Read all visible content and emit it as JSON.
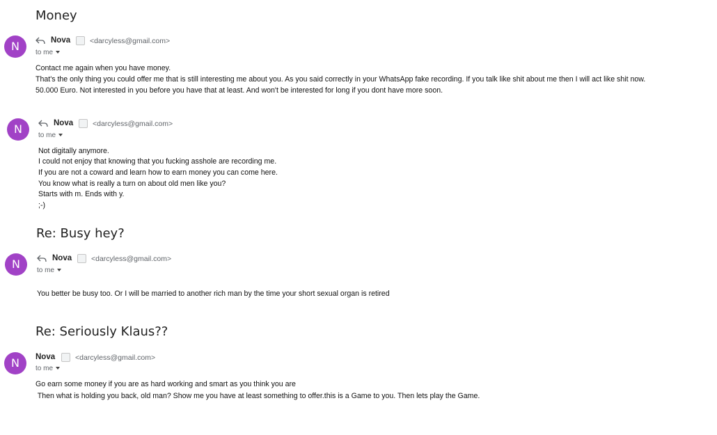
{
  "emails": [
    {
      "subject": "Money",
      "avatar_letter": "N",
      "sender_name": "Nova",
      "sender_email": "<darcyless@gmail.com>",
      "recipient": "to me",
      "body_lines": [
        "Contact me again when you have money.",
        "That's the only thing you could offer me that is still interesting me about you. As you said correctly in your WhatsApp fake recording. If you talk like shit about me then I will act like shit now.",
        "50.000 Euro. Not interested in you before you have that at least. And won't be interested for long if you dont have more soon."
      ]
    },
    {
      "subject": "",
      "avatar_letter": "N",
      "sender_name": "Nova",
      "sender_email": "<darcyless@gmail.com>",
      "recipient": "to me",
      "body_lines": [
        "Not digitally anymore.",
        "I could not enjoy that knowing that you fucking asshole are recording me.",
        "If you are not a coward and learn how to earn money you can come here.",
        "You know what is really a turn on about old men like you?",
        "Starts with m. Ends with y.",
        ";-)"
      ]
    },
    {
      "subject": "Re: Busy hey?",
      "avatar_letter": "N",
      "sender_name": "Nova",
      "sender_email": "<darcyless@gmail.com>",
      "recipient": "to me",
      "body_lines": [
        "You better be busy too. Or I will be married to another rich man by the time your short sexual organ is retired"
      ]
    },
    {
      "subject": "Re: Seriously Klaus??",
      "avatar_letter": "N",
      "sender_name": "Nova",
      "sender_email": "<darcyless@gmail.com>",
      "recipient": "to me",
      "body_lines": [
        "Go earn some money if you are as hard working and smart as you think you are",
        " Then what is holding you back, old man? Show me you have at least something to offer.this is a Game to you. Then lets play the Game."
      ]
    }
  ],
  "colors": {
    "avatar": "#a142c6",
    "secondary_text": "#5f6368"
  },
  "icons": [
    "reply-icon",
    "contact-icon",
    "chevron-down-icon"
  ]
}
